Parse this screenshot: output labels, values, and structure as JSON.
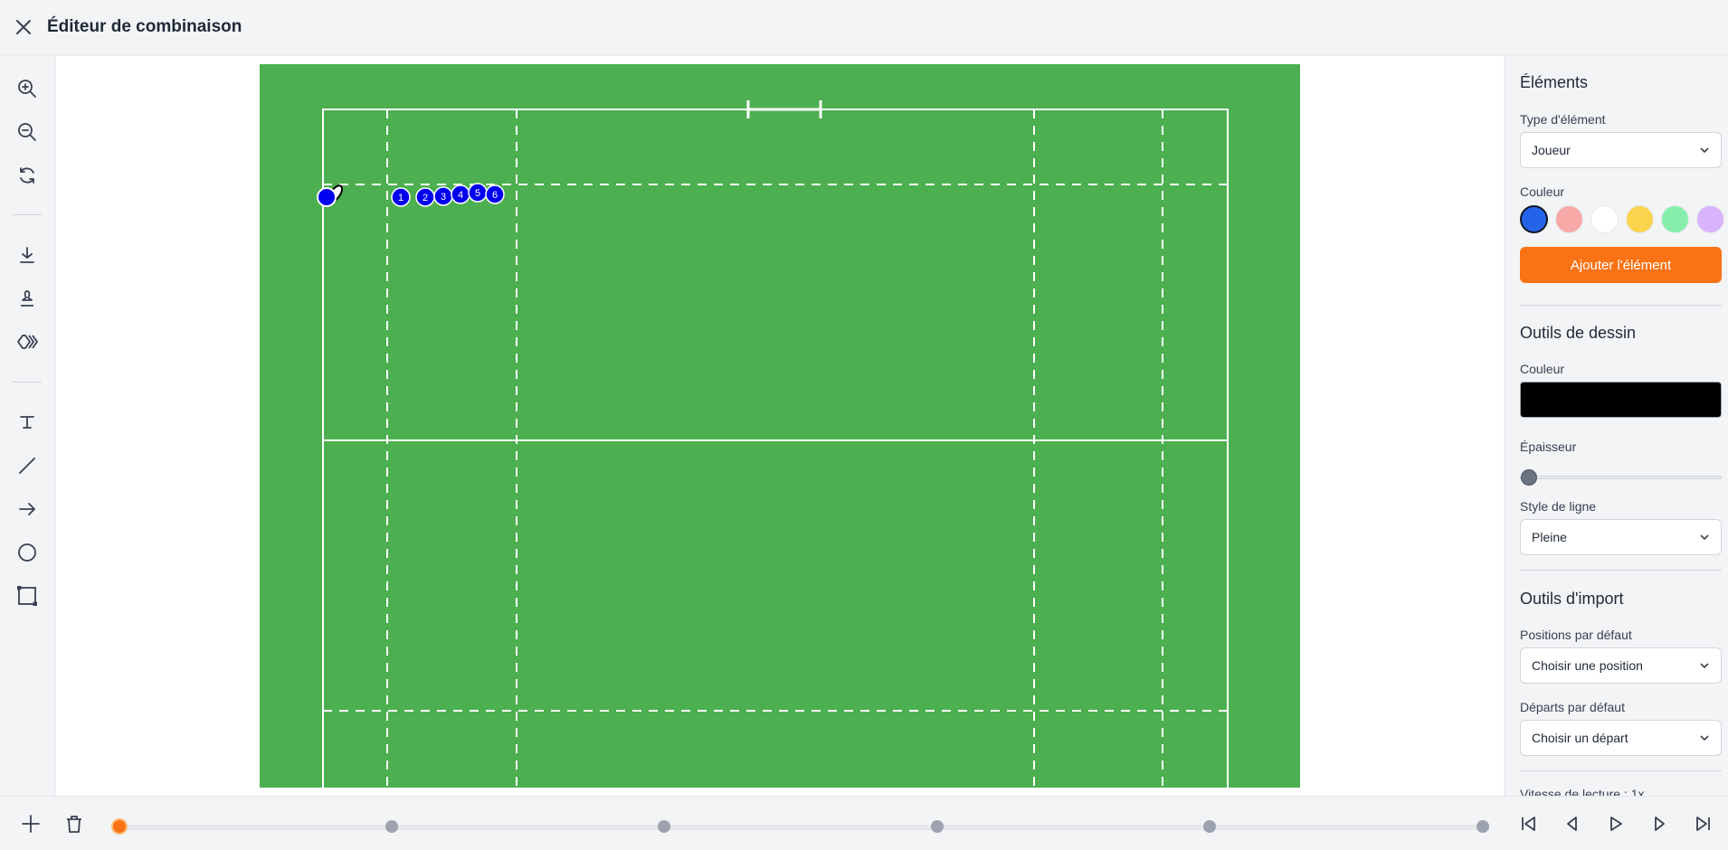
{
  "header": {
    "title": "Éditeur de combinaison"
  },
  "colors": {
    "field": "#4caf50",
    "accent": "#f97316",
    "player": "#0000ee"
  },
  "players": [
    "1",
    "2",
    "3",
    "4",
    "5",
    "6"
  ],
  "panel": {
    "elements": {
      "title": "Éléments",
      "type_label": "Type d'élément",
      "type_value": "Joueur",
      "color_label": "Couleur",
      "swatches": [
        "#2563eb",
        "#f9a8a8",
        "#ffffff",
        "#fcd34d",
        "#86efac",
        "#d8b4fe"
      ],
      "add_label": "Ajouter l'élément"
    },
    "drawing": {
      "title": "Outils de dessin",
      "color_label": "Couleur",
      "color_value": "#000000",
      "thickness_label": "Épaisseur",
      "thickness_level": 0,
      "line_style_label": "Style de ligne",
      "line_style_value": "Pleine"
    },
    "import": {
      "title": "Outils d'import",
      "positions_label": "Positions par défaut",
      "positions_placeholder": "Choisir une position",
      "starts_label": "Départs par défaut",
      "starts_placeholder": "Choisir un départ",
      "speed_label": "Vitesse de lecture : 1x"
    }
  },
  "timeline": {
    "keyframes": 6,
    "active": 0
  }
}
